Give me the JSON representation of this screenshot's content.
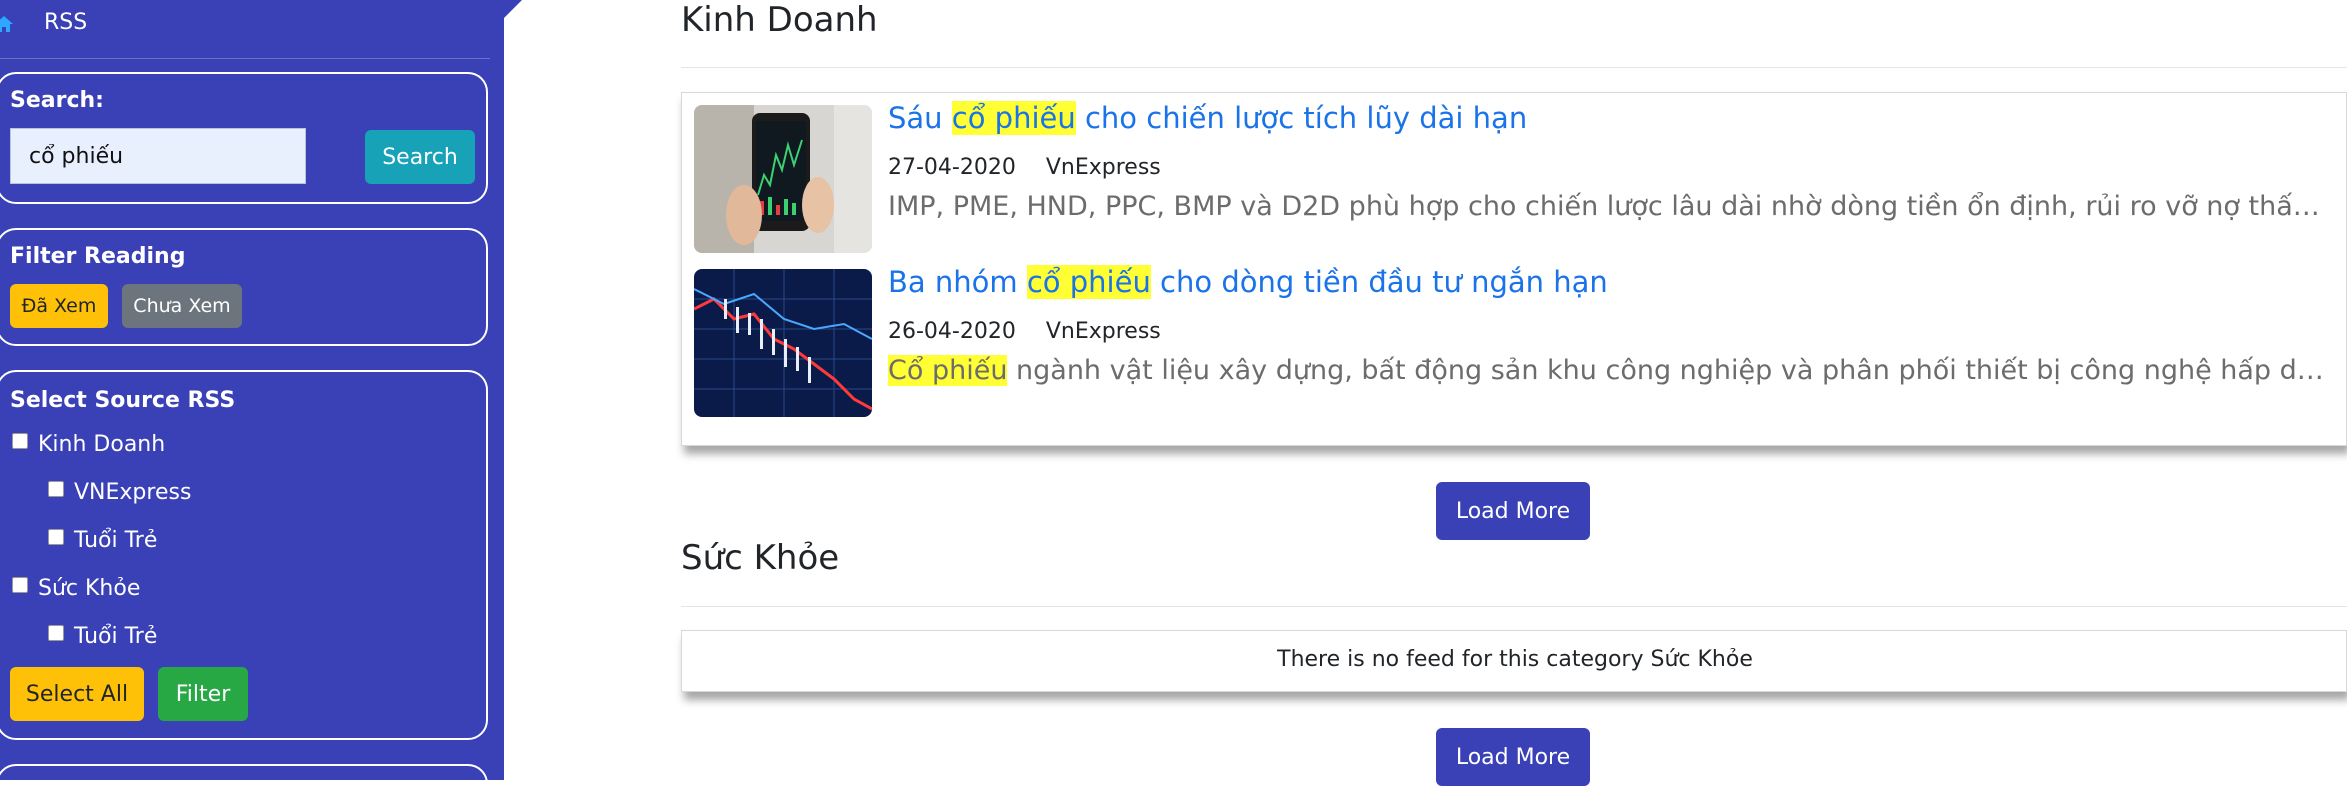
{
  "sidebar": {
    "brand": "RSS",
    "search": {
      "label": "Search:",
      "value": "cổ phiếu",
      "button": "Search"
    },
    "filter_reading": {
      "title": "Filter Reading",
      "seen": "Đã Xem",
      "unseen": "Chưa Xem"
    },
    "source": {
      "title": "Select Source RSS",
      "items": [
        {
          "label": "Kinh Doanh"
        },
        {
          "label": "VNExpress"
        },
        {
          "label": "Tuổi Trẻ"
        },
        {
          "label": "Sức Khỏe"
        },
        {
          "label": "Tuổi Trẻ"
        }
      ],
      "select_all": "Select All",
      "filter": "Filter"
    }
  },
  "main": {
    "sections": [
      {
        "title": "Kinh Doanh",
        "articles": [
          {
            "title_pre": "Sáu ",
            "title_hl": "cổ phiếu",
            "title_post": " cho chiến lược tích lũy dài hạn",
            "date": "27-04-2020",
            "source": "VnExpress",
            "desc_hl": "",
            "desc": "IMP, PME, HND, PPC, BMP và D2D phù hợp cho chiến lược lâu dài nhờ dòng tiền ổn định, rủi ro vỡ nợ thấp và tăng trưởng tốt."
          },
          {
            "title_pre": "Ba nhóm ",
            "title_hl": "cổ phiếu",
            "title_post": " cho dòng tiền đầu tư ngắn hạn",
            "date": "26-04-2020",
            "source": "VnExpress",
            "desc_hl": "Cổ phiếu",
            "desc": " ngành vật liệu xây dựng, bất động sản khu công nghiệp và phân phối thiết bị công nghệ hấp dẫn nhờ giá hấp dẫn."
          }
        ],
        "load_more": "Load More"
      },
      {
        "title": "Sức Khỏe",
        "empty": "There is no feed for this category Sức Khỏe",
        "load_more": "Load More"
      }
    ]
  }
}
